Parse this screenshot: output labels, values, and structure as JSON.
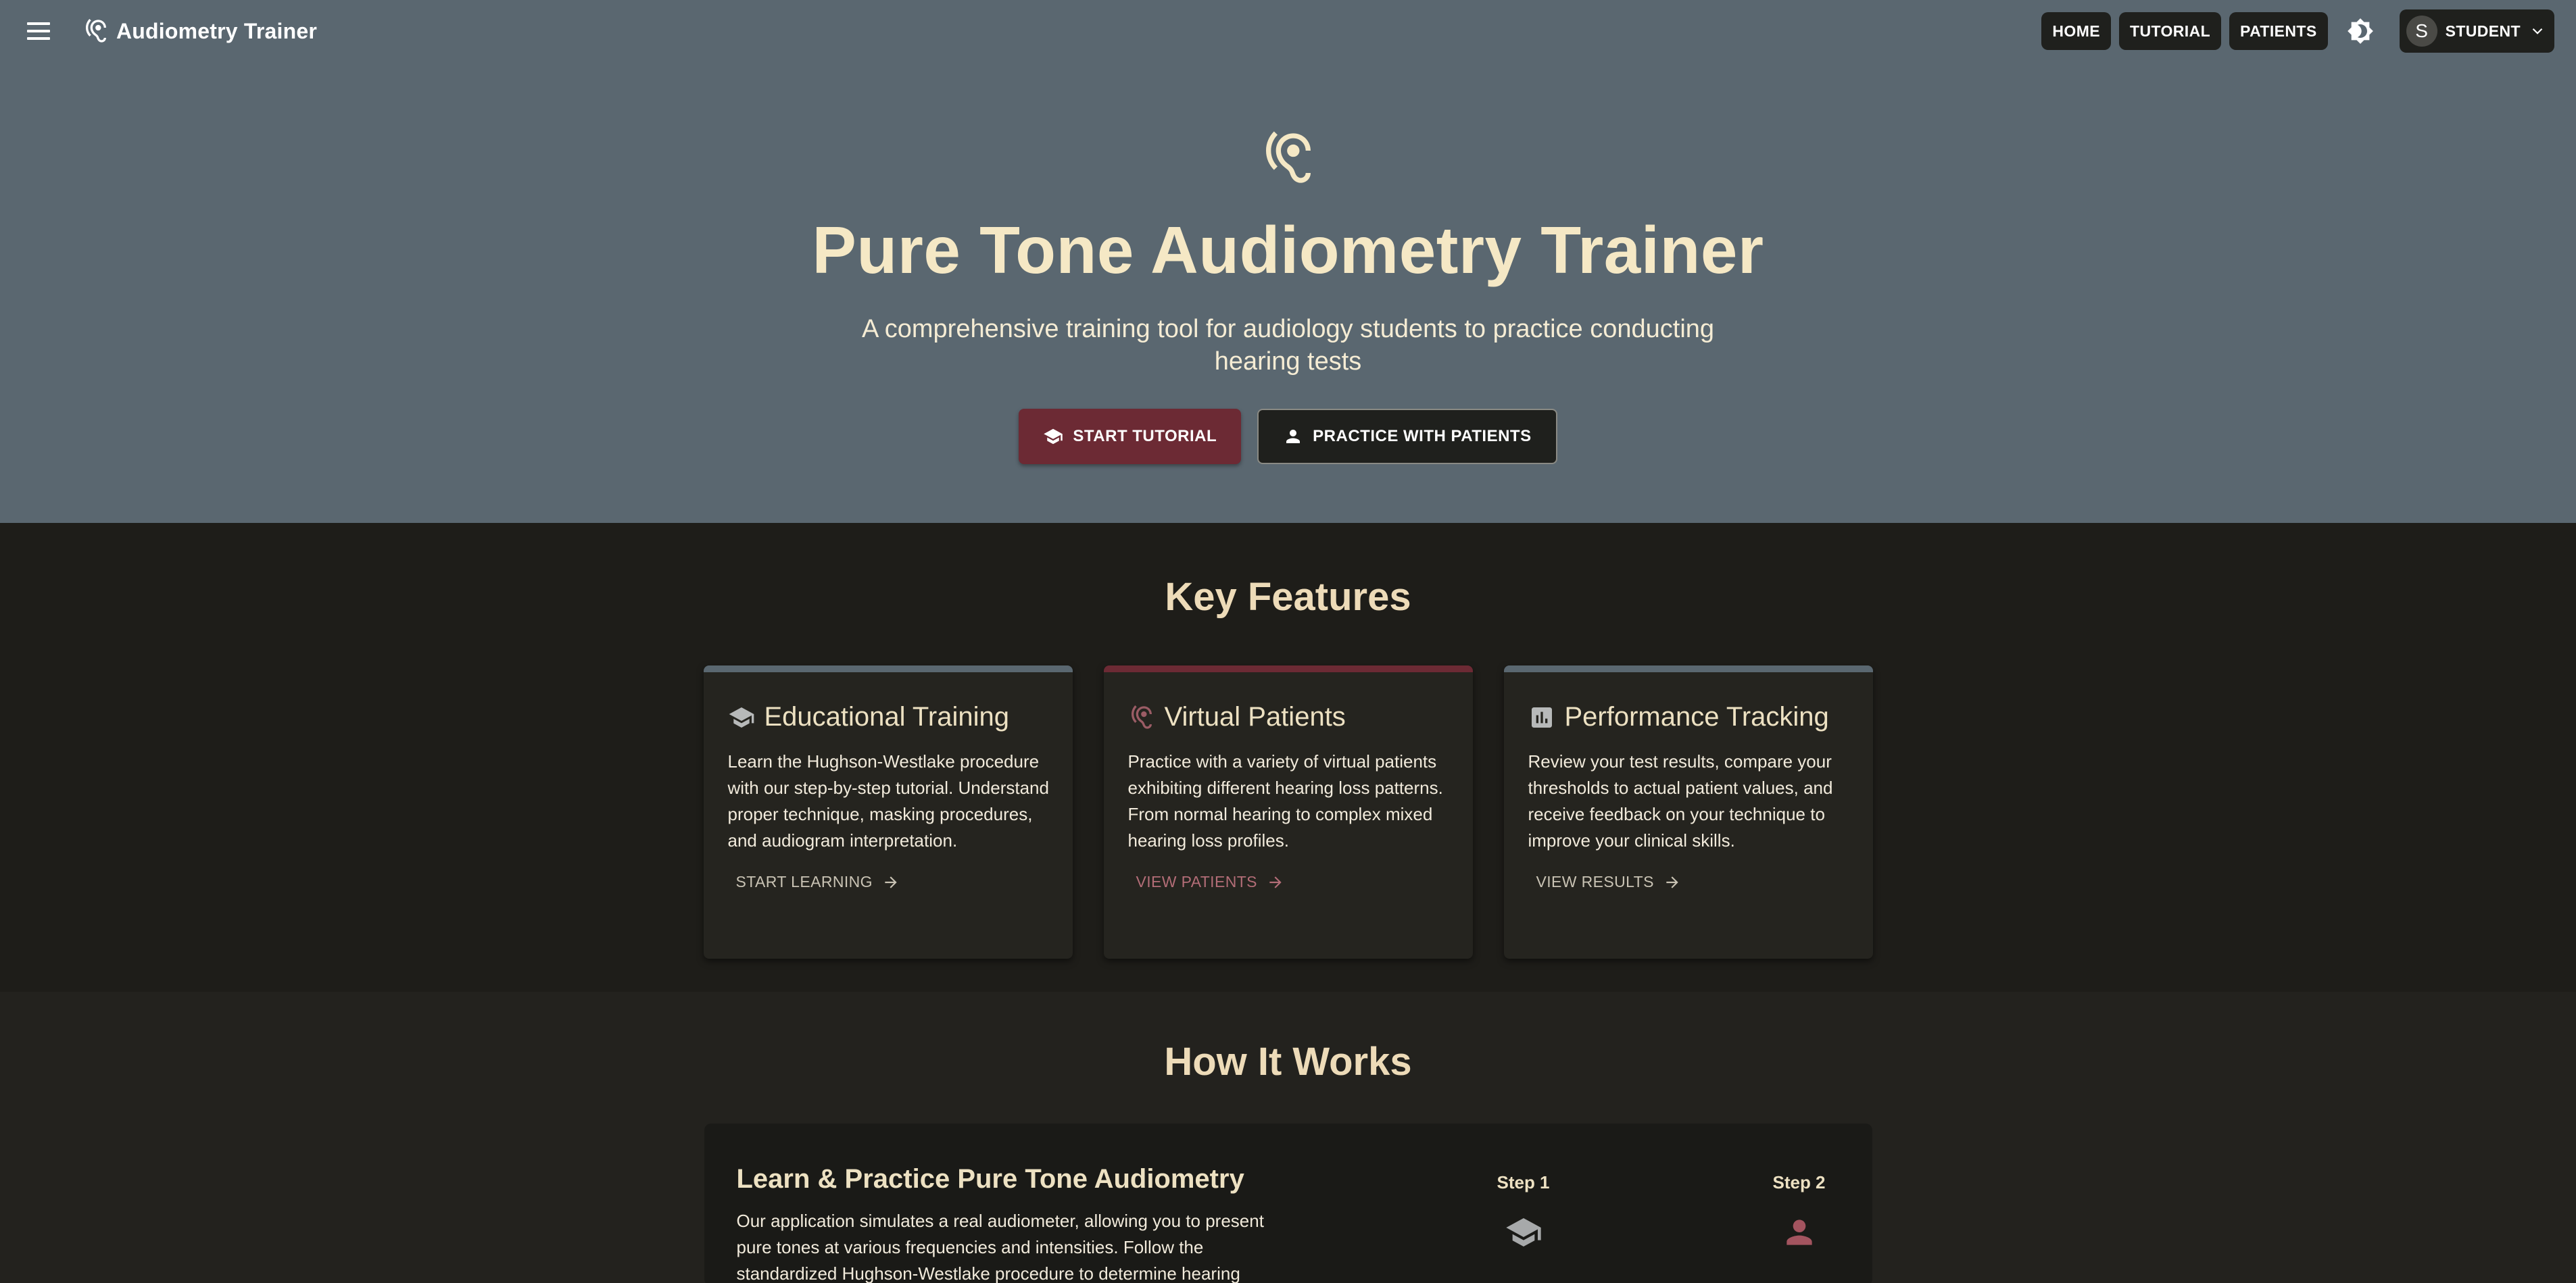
{
  "colors": {
    "hero_bg": "#5a6770",
    "primary": "#6c2a34",
    "page_bg": "#1e1d19",
    "card_bg": "#25241f",
    "accent_cream": "#f5e8c5",
    "bar_slate": "#5a6770",
    "bar_wine": "#6c2a34",
    "link_muted": "#c9c3b4",
    "link_rose": "#b36d77"
  },
  "appbar": {
    "title": "Audiometry Trainer",
    "nav": [
      {
        "label": "HOME"
      },
      {
        "label": "TUTORIAL"
      },
      {
        "label": "PATIENTS"
      }
    ],
    "theme_icon": "brightness-icon",
    "user": {
      "initial": "S",
      "label": "STUDENT"
    }
  },
  "hero": {
    "icon": "hearing-icon",
    "title": "Pure Tone Audiometry Trainer",
    "subtitle": "A comprehensive training tool for audiology students to practice conducting hearing tests",
    "primary_button": {
      "label": "START TUTORIAL",
      "icon": "school-icon"
    },
    "secondary_button": {
      "label": "PRACTICE WITH PATIENTS",
      "icon": "person-icon"
    }
  },
  "features": {
    "title": "Key Features",
    "cards": [
      {
        "title": "Educational Training",
        "icon": "school-icon",
        "text": "Learn the Hughson-Westlake procedure with our step-by-step tutorial. Understand proper technique, masking procedures, and audiogram interpretation.",
        "link": "START LEARNING"
      },
      {
        "title": "Virtual Patients",
        "icon": "hearing-icon",
        "text": "Practice with a variety of virtual patients exhibiting different hearing loss patterns. From normal hearing to complex mixed hearing loss profiles.",
        "link": "VIEW PATIENTS"
      },
      {
        "title": "Performance Tracking",
        "icon": "assessment-icon",
        "text": "Review your test results, compare your thresholds to actual patient values, and receive feedback on your technique to improve your clinical skills.",
        "link": "VIEW RESULTS"
      }
    ]
  },
  "how": {
    "title": "How It Works",
    "card_title": "Learn & Practice Pure Tone Audiometry",
    "card_text": "Our application simulates a real audiometer, allowing you to present pure tones at various frequencies and intensities. Follow the standardized Hughson-Westlake procedure to determine hearing",
    "steps": [
      {
        "label": "Step 1",
        "icon": "school-icon"
      },
      {
        "label": "Step 2",
        "icon": "person-icon"
      }
    ]
  }
}
